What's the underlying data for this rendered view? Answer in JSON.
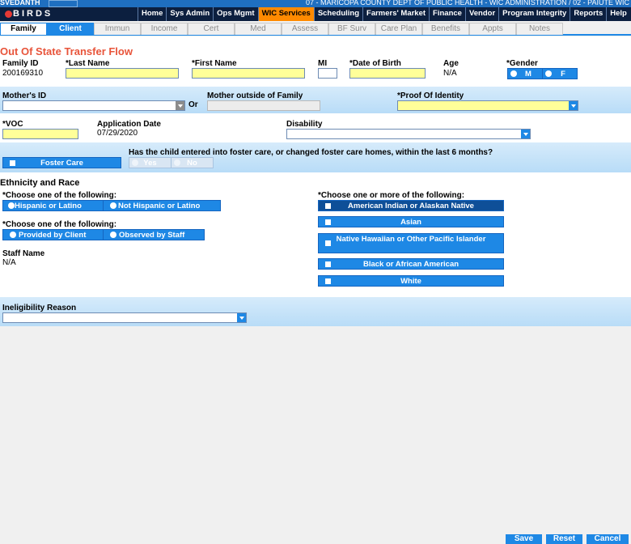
{
  "header": {
    "user": "SVEDANTH",
    "org": "07 - MARICOPA COUNTY DEPT OF PUBLIC HEALTH - WIC ADMINISTRATION / 02 - PAIUTE WIC",
    "logo_text": "BIRDS"
  },
  "menu": [
    "Home",
    "Sys Admin",
    "Ops Mgmt",
    "WIC Services",
    "Scheduling",
    "Farmers' Market",
    "Finance",
    "Vendor",
    "Program Integrity",
    "Reports",
    "Help"
  ],
  "menu_active": "WIC Services",
  "tabs": [
    "Family",
    "Client",
    "Immun",
    "Income",
    "Cert",
    "Med",
    "Assess",
    "BF Surv",
    "Care Plan",
    "Benefits",
    "Appts",
    "Notes"
  ],
  "form": {
    "title": "Out Of State Transfer Flow",
    "family_id_label": "Family ID",
    "family_id_value": "200169310",
    "last_name_label": "*Last Name",
    "first_name_label": "*First Name",
    "mi_label": "MI",
    "dob_label": "*Date of Birth",
    "age_label": "Age",
    "age_value": "N/A",
    "gender_label": "*Gender",
    "gender_m": "M",
    "gender_f": "F",
    "mothers_id_label": "Mother's ID",
    "or_label": "Or",
    "mother_outside_label": "Mother outside of Family",
    "proof_identity_label": "*Proof Of Identity",
    "voc_label": "*VOC",
    "application_date_label": "Application Date",
    "application_date_value": "07/29/2020",
    "disability_label": "Disability",
    "foster_care_label": "Foster Care",
    "foster_question": "Has the child entered into foster care, or changed foster care homes, within the last 6 months?",
    "yes_label": "Yes",
    "no_label": "No",
    "ethnicity_title": "Ethnicity and Race",
    "choose_one_1": "*Choose one of the following:",
    "hispanic": "Hispanic or Latino",
    "not_hispanic": "Not Hispanic or Latino",
    "choose_one_2": "*Choose one of the following:",
    "provided_by_client": "Provided by Client",
    "observed_by_staff": "Observed by Staff",
    "staff_name_label": "Staff Name",
    "staff_name_value": "N/A",
    "choose_more": "*Choose one or more of the following:",
    "race_options": [
      "American Indian or Alaskan Native",
      "Asian",
      "Native Hawaiian or Other Pacific Islander",
      "Black or African American",
      "White"
    ],
    "ineligibility_label": "Ineligibility Reason"
  },
  "footer": {
    "save": "Save",
    "reset": "Reset",
    "cancel": "Cancel"
  }
}
